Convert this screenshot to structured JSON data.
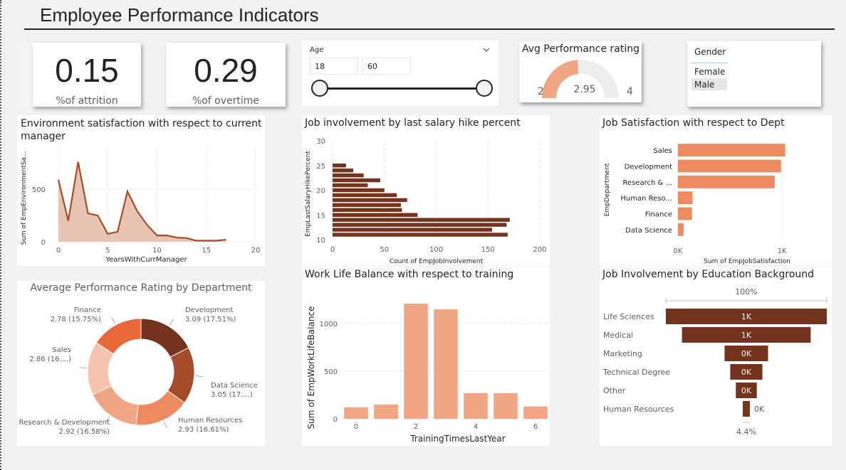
{
  "page": {
    "title": "Employee Performance Indicators"
  },
  "kpis": [
    {
      "value": "0.15",
      "label": "%of attrition"
    },
    {
      "value": "0.29",
      "label": "%of overtime"
    }
  ],
  "age_slicer": {
    "title": "Age",
    "min": "18",
    "max": "60"
  },
  "gauge": {
    "title": "Avg Performance rating",
    "min": "2",
    "max": "4",
    "value": "2.95",
    "fraction": 0.475,
    "fill_color": "#F0A685",
    "track_color": "#ededed"
  },
  "gender_slicer": {
    "title": "Gender",
    "items": [
      {
        "label": "Female",
        "selected": false
      },
      {
        "label": "Male",
        "selected": true
      }
    ]
  },
  "colors": {
    "dark": "#73331C",
    "medium": "#A54D28",
    "accent": "#EE8A5F",
    "light": "#F0A685",
    "lighter": "#F5C4AE"
  },
  "chart_data": [
    {
      "id": "env",
      "type": "area",
      "title": "Environment satisfaction with respect to current manager",
      "xlabel": "YearsWithCurrManager",
      "ylabel": "Sum of EmpEnvironmentSa...",
      "xlim": [
        0,
        20
      ],
      "ylim": [
        0,
        900
      ],
      "x_ticks": [
        "0",
        "5",
        "10",
        "15",
        "20"
      ],
      "y_ticks": [
        "0",
        "500"
      ],
      "x": [
        0,
        1,
        2,
        3,
        4,
        5,
        6,
        7,
        8,
        9,
        10,
        11,
        12,
        13,
        14,
        15,
        16,
        17
      ],
      "values": [
        590,
        200,
        760,
        270,
        250,
        75,
        95,
        480,
        290,
        160,
        60,
        60,
        40,
        35,
        10,
        10,
        10,
        20
      ]
    },
    {
      "id": "jobinv",
      "type": "bar",
      "orientation": "horizontal",
      "title": "Job involvement by last salary hike percent",
      "xlabel": "Count of EmpJobInvolvement",
      "ylabel": "EmpLastSalaryHikePercent",
      "xlim": [
        0,
        200
      ],
      "ylim": [
        10,
        30
      ],
      "x_ticks": [
        "0",
        "50",
        "100",
        "150",
        "200"
      ],
      "y_ticks": [
        "10",
        "15",
        "20",
        "25",
        "30"
      ],
      "categories": [
        11,
        12,
        13,
        14,
        15,
        16,
        17,
        18,
        19,
        20,
        21,
        22,
        23,
        24,
        25
      ],
      "values": [
        169,
        154,
        168,
        171,
        82,
        67,
        66,
        72,
        62,
        50,
        34,
        46,
        30,
        20,
        13
      ]
    },
    {
      "id": "jobsat",
      "type": "bar",
      "orientation": "horizontal",
      "title": "Job Satisfaction with respect to Dept",
      "xlabel": "Sum of EmpJobSatisfaction",
      "ylabel": "EmpDepartment",
      "x_ticks": [
        "0K",
        "1K"
      ],
      "xlim": [
        0,
        1300
      ],
      "categories": [
        "Sales",
        "Development",
        "Research & ...",
        "Human Reso...",
        "Finance",
        "Data Science"
      ],
      "values": [
        1030,
        990,
        930,
        140,
        135,
        55
      ]
    },
    {
      "id": "perfdept",
      "type": "pie",
      "title": "Average Performance Rating by Department",
      "slices": [
        {
          "label": "Development",
          "value": 3.09,
          "pct": "3.09 (17.51%)"
        },
        {
          "label": "Data Science",
          "value": 3.05,
          "pct": "3.05 (17....)"
        },
        {
          "label": "Human Resources",
          "value": 2.93,
          "pct": "2.93 (16.61%)"
        },
        {
          "label": "Research & Development",
          "value": 2.92,
          "pct": "2.92 (16.58%)"
        },
        {
          "label": "Sales",
          "value": 2.86,
          "pct": "2.86 (16....)"
        },
        {
          "label": "Finance",
          "value": 2.78,
          "pct": "2.78 (15.75%)"
        }
      ]
    },
    {
      "id": "wlb",
      "type": "bar",
      "title": "Work Life Balance with respect to training",
      "xlabel": "TrainingTimesLastYear",
      "ylabel": "Sum of EmpWorkLifeBalance",
      "ylim": [
        0,
        1300
      ],
      "y_ticks": [
        "0",
        "500",
        "1000"
      ],
      "x_ticks": [
        "0",
        "2",
        "4",
        "6"
      ],
      "categories": [
        0,
        1,
        2,
        3,
        4,
        5,
        6
      ],
      "values": [
        120,
        150,
        1210,
        1150,
        270,
        270,
        130
      ]
    },
    {
      "id": "edu",
      "type": "bar",
      "orientation": "funnel",
      "title": "Job Involvement by Education Background",
      "top_label": "100%",
      "bottom_label": "4.4%",
      "categories": [
        "Life Sciences",
        "Medical",
        "Marketing",
        "Technical Degree",
        "Other",
        "Human Resources"
      ],
      "values": [
        1.0,
        0.8,
        0.27,
        0.2,
        0.13,
        0.044
      ],
      "labels": [
        "1K",
        "1K",
        "0K",
        "0K",
        "0K",
        "0K"
      ]
    }
  ]
}
